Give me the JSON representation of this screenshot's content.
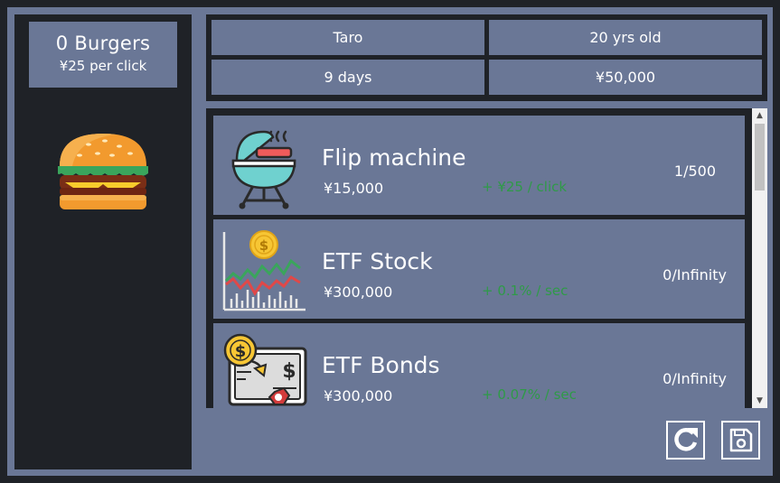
{
  "player": {
    "burgers": "0 Burgers",
    "per_click": "¥25 per click"
  },
  "status": {
    "name": "Taro",
    "age": "20 yrs old",
    "days": "9 days",
    "money": "¥50,000"
  },
  "items": [
    {
      "name": "Flip machine",
      "price": "¥15,000",
      "effect": "+ ¥25 / click",
      "count": "1/500",
      "icon": "grill-icon"
    },
    {
      "name": "ETF Stock",
      "price": "¥300,000",
      "effect": "+ 0.1% / sec",
      "count": "0/Infinity",
      "icon": "stock-chart-icon"
    },
    {
      "name": "ETF Bonds",
      "price": "¥300,000",
      "effect": "+ 0.07% / sec",
      "count": "0/Infinity",
      "icon": "bond-certificate-icon"
    }
  ],
  "buttons": {
    "reset_icon": "reset-icon",
    "save_icon": "save-icon"
  },
  "colors": {
    "background": "#1f2227",
    "panel": "#6a7796",
    "effect_text": "#2f9a48"
  }
}
